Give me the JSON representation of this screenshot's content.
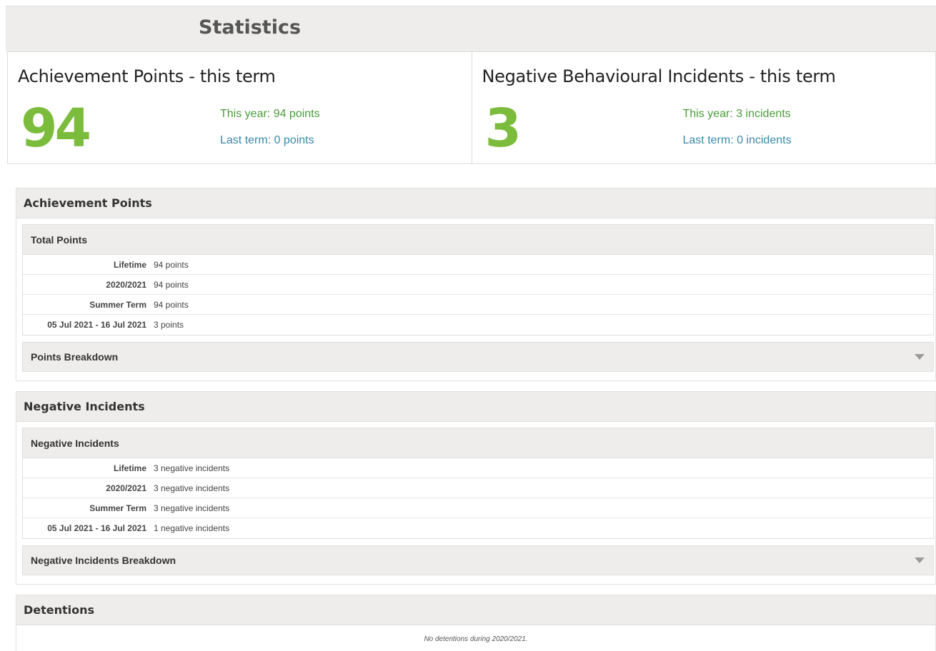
{
  "header": {
    "title": "Statistics"
  },
  "panels": {
    "achievement": {
      "title": "Achievement Points - this term",
      "value": "94",
      "this_year": "This year: 94 points",
      "last_term": "Last term: 0 points"
    },
    "negative": {
      "title": "Negative Behavioural Incidents - this term",
      "value": "3",
      "this_year": "This year: 3 incidents",
      "last_term": "Last term: 0 incidents"
    }
  },
  "achievement_section": {
    "title": "Achievement Points",
    "subtitle": "Total Points",
    "rows": [
      {
        "label": "Lifetime",
        "value": "94 points"
      },
      {
        "label": "2020/2021",
        "value": "94 points"
      },
      {
        "label": "Summer Term",
        "value": "94 points"
      },
      {
        "label": "05 Jul 2021 - 16 Jul 2021",
        "value": "3 points"
      }
    ],
    "breakdown": "Points Breakdown"
  },
  "negative_section": {
    "title": "Negative Incidents",
    "subtitle": "Negative Incidents",
    "rows": [
      {
        "label": "Lifetime",
        "value": "3 negative incidents"
      },
      {
        "label": "2020/2021",
        "value": "3 negative incidents"
      },
      {
        "label": "Summer Term",
        "value": "3 negative incidents"
      },
      {
        "label": "05 Jul 2021 - 16 Jul 2021",
        "value": "1 negative incidents"
      }
    ],
    "breakdown": "Negative Incidents Breakdown"
  },
  "detentions_section": {
    "title": "Detentions",
    "empty_text": "No detentions during 2020/2021."
  },
  "colors": {
    "big_number": "#7cbc3c",
    "this_year": "#4a9c3a",
    "last_term": "#3a88a6",
    "header_bg": "#eeedeb"
  },
  "icons": {
    "expand": "chevron-down-icon"
  }
}
